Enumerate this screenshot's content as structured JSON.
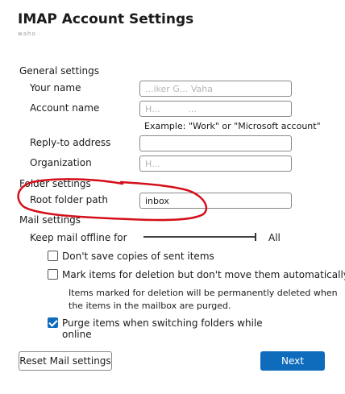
{
  "dialog": {
    "title": "IMAP Account Settings",
    "subtitle": "waho"
  },
  "general": {
    "heading": "General settings",
    "your_name_label": "Your name",
    "your_name_value": "...iker G... Vaha",
    "account_name_label": "Account name",
    "account_name_value": "H...          ...",
    "account_name_hint": "Example: \"Work\" or \"Microsoft account\"",
    "reply_to_label": "Reply-to address",
    "reply_to_value": "",
    "organization_label": "Organization",
    "organization_value": "H..."
  },
  "folder": {
    "heading": "Folder settings",
    "root_folder_label": "Root folder path",
    "root_folder_value": "inbox"
  },
  "mail": {
    "heading": "Mail settings",
    "offline_label": "Keep mail offline for",
    "offline_value": "All",
    "offline_level": 1.0,
    "dont_save_sent_label": "Don't save copies of sent items",
    "dont_save_sent_checked": false,
    "mark_deletion_label": "Mark items for deletion but don't move them automatically",
    "mark_deletion_checked": false,
    "mark_deletion_note_line1": "Items marked for deletion will be permanently deleted when",
    "mark_deletion_note_line2": "the items in the mailbox are purged.",
    "purge_label": "Purge items when switching folders while online",
    "purge_checked": true
  },
  "buttons": {
    "reset_label": "Reset Mail settings",
    "next_label": "Next"
  },
  "annotation": {
    "color": "#d4101a"
  },
  "colors": {
    "accent": "#0f6cbd"
  }
}
